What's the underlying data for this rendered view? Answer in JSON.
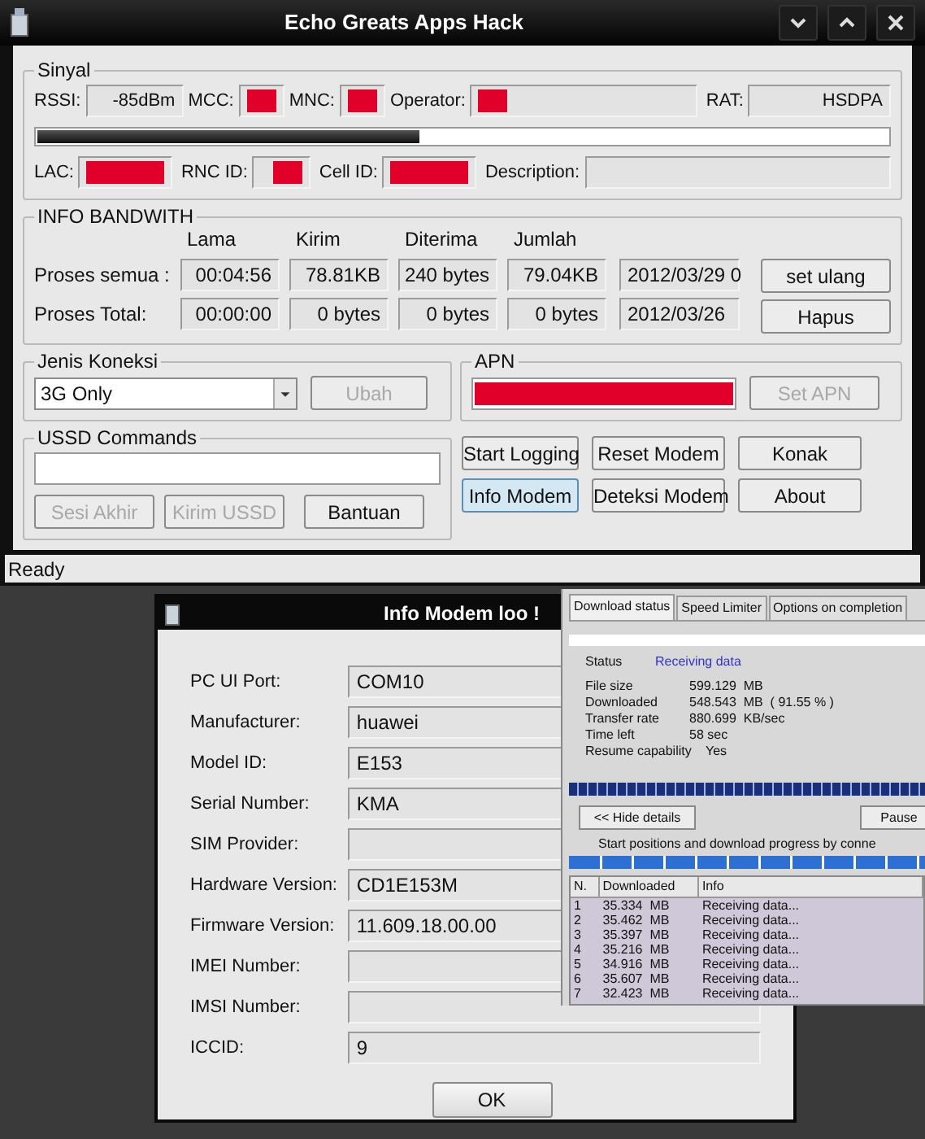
{
  "main_window": {
    "title": "Echo Greats Apps Hack",
    "signal": {
      "legend": "Sinyal",
      "row_1": [
        {
          "label": "RSSI:",
          "value": "-85dBm"
        },
        {
          "label": "MCC:",
          "redacted": true
        },
        {
          "label": "MNC:",
          "redacted": true
        },
        {
          "label": "Operator:",
          "redacted": true
        },
        {
          "label": "RAT:",
          "value": "HSDPA"
        }
      ],
      "strength": {
        "level": 0.45
      },
      "row_2": [
        {
          "label": "LAC:",
          "redacted": true
        },
        {
          "label": "RNC ID:",
          "redacted": true
        },
        {
          "label": "Cell ID:",
          "redacted": true
        },
        {
          "label": "Description:"
        }
      ]
    },
    "bandwidth": {
      "legend": "INFO BANDWITH",
      "columns": [
        "Lama",
        "Kirim",
        "Diterima",
        "Jumlah"
      ],
      "rows": [
        {
          "label": "Proses semua :",
          "values": [
            "00:04:56",
            "78.81KB",
            "240 bytes",
            "79.04KB"
          ],
          "date": "2012/03/29 0"
        },
        {
          "label": "Proses Total:",
          "values": [
            "00:00:00",
            "0 bytes",
            "0 bytes",
            "0 bytes"
          ],
          "date": "2012/03/26"
        }
      ],
      "buttons": [
        "set ulang",
        "Hapus"
      ]
    },
    "connection": {
      "legend": "Jenis Koneksi",
      "value": "3G Only",
      "button": {
        "label": "Ubah",
        "disabled": true
      }
    },
    "apn": {
      "legend": "APN",
      "redacted": true,
      "button": {
        "label": "Set APN",
        "disabled": true
      }
    },
    "ussd": {
      "legend": "USSD Commands",
      "buttons": [
        {
          "label": "Sesi Akhir",
          "disabled": true
        },
        {
          "label": "Kirim USSD",
          "disabled": true
        },
        {
          "label": "Bantuan",
          "disabled": false
        }
      ]
    },
    "actions": [
      {
        "label": "Start Logging",
        "focused": false
      },
      {
        "label": "Reset Modem",
        "focused": false
      },
      {
        "label": "Konak",
        "focused": false
      },
      {
        "label": "Info Modem",
        "focused": true
      },
      {
        "label": "Deteksi Modem",
        "focused": false
      },
      {
        "label": "About",
        "focused": false
      }
    ],
    "status_bar": "Ready"
  },
  "modem_dialog": {
    "title": "Info Modem loo !",
    "fields": [
      {
        "label": "PC UI Port:",
        "value": "COM10"
      },
      {
        "label": "Manufacturer:",
        "value": "huawei"
      },
      {
        "label": "Model ID:",
        "value": "E153"
      },
      {
        "label": "Serial Number:",
        "value": "KMA"
      },
      {
        "label": "SIM Provider:"
      },
      {
        "label": "Hardware Version:",
        "value": "CD1E153M"
      },
      {
        "label": "Firmware Version:",
        "value": "11.609.18.00.00"
      },
      {
        "label": "IMEI Number:"
      },
      {
        "label": "IMSI Number:"
      },
      {
        "label": "ICCID:",
        "value": "9"
      }
    ],
    "button": "OK"
  },
  "download_window": {
    "tabs": [
      {
        "label": "Download status",
        "selected": true
      },
      {
        "label": "Speed Limiter",
        "selected": false
      },
      {
        "label": "Options on completion",
        "selected": false
      }
    ],
    "status": {
      "label": "Status",
      "value": "Receiving data"
    },
    "details": [
      {
        "label": "File size",
        "value": "599.129  MB"
      },
      {
        "label": "Downloaded",
        "value": "548.543  MB  ( 91.55 % )"
      },
      {
        "label": "Transfer rate",
        "value": "880.699  KB/sec"
      },
      {
        "label": "Time left",
        "value": "58 sec"
      },
      {
        "label": "Resume capability",
        "value": "Yes"
      }
    ],
    "buttons": [
      "<< Hide details",
      "Pause"
    ],
    "caption": "Start positions and download progress by conne",
    "table": {
      "columns": [
        "N.",
        "Downloaded",
        "Info"
      ],
      "rows": [
        [
          "1",
          "35.334  MB",
          "Receiving data..."
        ],
        [
          "2",
          "35.462  MB",
          "Receiving data..."
        ],
        [
          "3",
          "35.397  MB",
          "Receiving data..."
        ],
        [
          "4",
          "35.216  MB",
          "Receiving data..."
        ],
        [
          "5",
          "34.916  MB",
          "Receiving data..."
        ],
        [
          "6",
          "35.607  MB",
          "Receiving data..."
        ],
        [
          "7",
          "32.423  MB",
          "Receiving data..."
        ]
      ]
    }
  }
}
